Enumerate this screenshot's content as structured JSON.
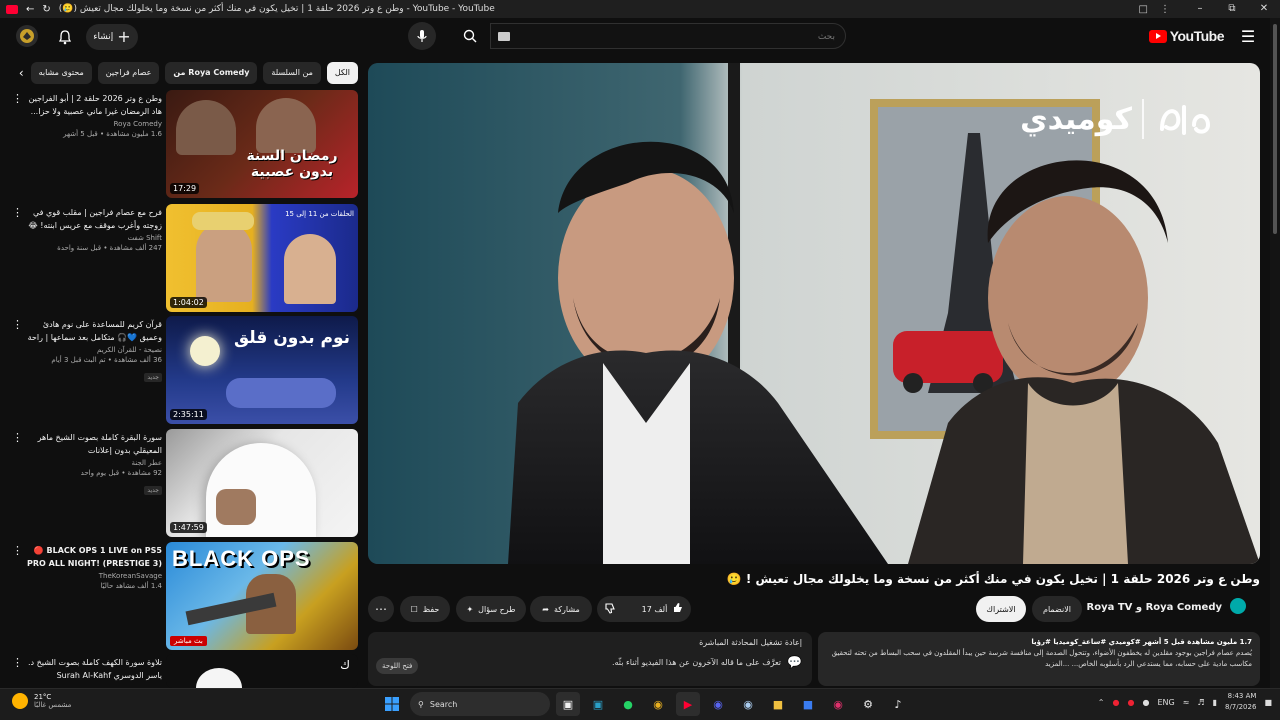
{
  "window": {
    "title": "(🥲) وطن ع وتر 2026 حلقة 1 | تخيل يكون في منك أكثر من نسخة وما يخلولك مجال تعيش - YouTube - YouTube",
    "buttons": [
      "minimize",
      "restore",
      "close"
    ]
  },
  "masthead": {
    "logo_text": "YouTube",
    "search_placeholder": "بحث",
    "create_label": "إنشاء"
  },
  "chips": [
    {
      "label": "الكل",
      "active": true
    },
    {
      "label": "من السلسلة",
      "active": false
    },
    {
      "label": "من Roya Comedy",
      "active": false,
      "bold": true
    },
    {
      "label": "عصام فراجين",
      "active": false
    },
    {
      "label": "محتوى مشابه",
      "active": false
    }
  ],
  "recommendations": [
    {
      "title": "وطن ع وتر 2026 حلقة 2 | أبو الفراجين هاد الرمضان غيرا ماني عصبية ولا حزا...",
      "channel": "Roya Comedy",
      "meta": "1.6 مليون مشاهدة • قبل 5 أشهر",
      "duration": "17:29",
      "badge": "",
      "thumb_text": "رمضان السنة بدون عصبية",
      "thumb_color": "#b8232a"
    },
    {
      "title": "فرح مع عصام فراجين | مقلب قوي في زوجته وأغرب موقف مع عريس ابنته! 😂🔥",
      "channel": "Shift شفت",
      "meta": "247 ألف مشاهدة • قبل سنة واحدة",
      "duration": "1:04:02",
      "badge": "",
      "thumb_text": "الحلقات من 11 إلى 15",
      "thumb_color": "#2a3bc4"
    },
    {
      "title": "قرآن كريم للمساعدة على نوم هادئ وعميق 💙🎧 متكامل بعد سماعها | راحة نفسية لا ...",
      "channel": "نصيحة - للقرآن الكريم",
      "meta": "36 ألف مشاهدة • تم البث قبل 3 أيام",
      "duration": "2:35:11",
      "badge": "جديد",
      "thumb_text": "نوم بدون قلق",
      "thumb_color": "#1b2a6b"
    },
    {
      "title": "سورة البقرة كاملة بصوت الشيخ ماهر المعيقلي بدون إعلانات",
      "channel": "عطر الجنة",
      "meta": "92 مشاهدة • قبل يوم واحد",
      "duration": "1:47:59",
      "badge": "جديد",
      "thumb_text": "",
      "thumb_color": "#d9d9d9"
    },
    {
      "title": "🔴 BLACK OPS 1 LIVE on PS5 PRO ALL NIGHT! (PRESTIGE 3)",
      "channel": "TheKoreanSavage",
      "meta": "1.4 ألف مشاهد حاليًا",
      "duration": "",
      "badge": "بث مباشر",
      "thumb_text": "BLACK OPS",
      "thumb_color": "#e8a000"
    },
    {
      "title": "تلاوة سورة الكهف كاملة بصوت الشيخ د. ياسر الدوسري Surah Al-Kahf",
      "channel": "",
      "meta": "",
      "duration": "",
      "badge": "",
      "thumb_text": "ك",
      "thumb_color": "#f5f5f5"
    }
  ],
  "video": {
    "watermark_left": "كوميدي",
    "title": "وطن ع وتر 2026 حلقة 1 | تخيل يكون في منك أكثر من نسخة وما يخلولك مجال تعيش ! 🥲",
    "channel": "Roya Comedy و Roya TV",
    "join_label": "الانضمام",
    "subscribe_label": "الاشتراك",
    "likes": "17 ألف",
    "share_label": "مشاركة",
    "ask_label": "طرح سؤال",
    "save_label": "حفظ"
  },
  "description": {
    "stats": "1.7 مليون مشاهدة  قبل 5 أشهر  #كوميدي #ساعة_كوميديا #رؤيا",
    "line1": "يُصدم عصام فراجين بوجود مقلدين له يخطفون الأضواء، وتتحول الصدمة إلى منافسة شرسة حين يبدأ المقلدون في سحب البساط من تحته لتحقيق",
    "line2": "مكاسب مادية على حسابه، مما يستدعي الرد بأسلوبه الخاص... ...المزيد"
  },
  "live_chat": {
    "title": "إعادة تشغيل المحادثة المباشرة",
    "note": "تعرَّف على ما قاله الآخرون عن هذا الفيديو أثناء بثّه.",
    "button": "فتح اللوحة"
  },
  "taskbar": {
    "weather_temp": "21°C",
    "weather_desc": "مشمس غالبًا",
    "search_label": "Search",
    "lang": "ENG",
    "time": "8:43 AM",
    "date": "8/7/2026"
  }
}
